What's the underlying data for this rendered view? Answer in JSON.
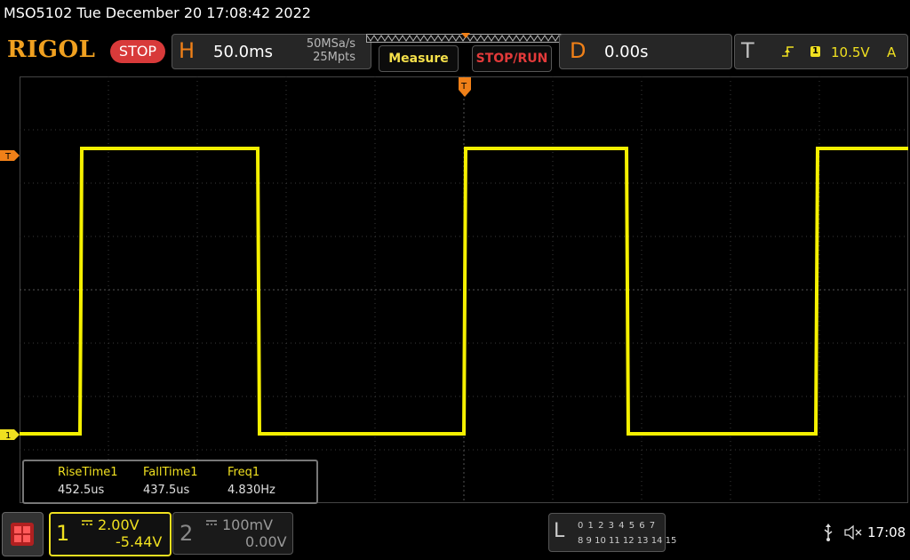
{
  "titlebar": {
    "text": "MSO5102  Tue December 20 17:08:42 2022"
  },
  "header": {
    "logo": "RIGOL",
    "run_state": "STOP",
    "horizontal": {
      "letter": "H",
      "timebase": "50.0ms",
      "sample_rate": "50MSa/s",
      "memory_depth": "25Mpts"
    },
    "measure_label": "Measure",
    "stoprun_label": "STOP/RUN",
    "delay": {
      "letter": "D",
      "value": "0.00s"
    },
    "trigger": {
      "letter": "T",
      "source": "1",
      "level": "10.5V",
      "mode": "A"
    }
  },
  "markers": {
    "trigger_level": "T",
    "channel1_offset": "1"
  },
  "waveform": {
    "color": "#f5f000",
    "description_high_low": [
      "high",
      "low"
    ]
  },
  "measurements": {
    "items": [
      {
        "label": "RiseTime1",
        "value": "452.5us"
      },
      {
        "label": "FallTime1",
        "value": "437.5us"
      },
      {
        "label": "Freq1",
        "value": "4.830Hz"
      }
    ]
  },
  "channels": {
    "ch1": {
      "number": "1",
      "scale": "2.00V",
      "offset": "-5.44V",
      "color": "#f0e020"
    },
    "ch2": {
      "number": "2",
      "scale": "100mV",
      "offset": "0.00V",
      "color": "#888888"
    }
  },
  "logic": {
    "letter": "L",
    "row1": "0 1 2 3  4 5 6 7",
    "row2": "8 9 10 11 12 13 14 15"
  },
  "statusbar": {
    "time": "17:08"
  }
}
